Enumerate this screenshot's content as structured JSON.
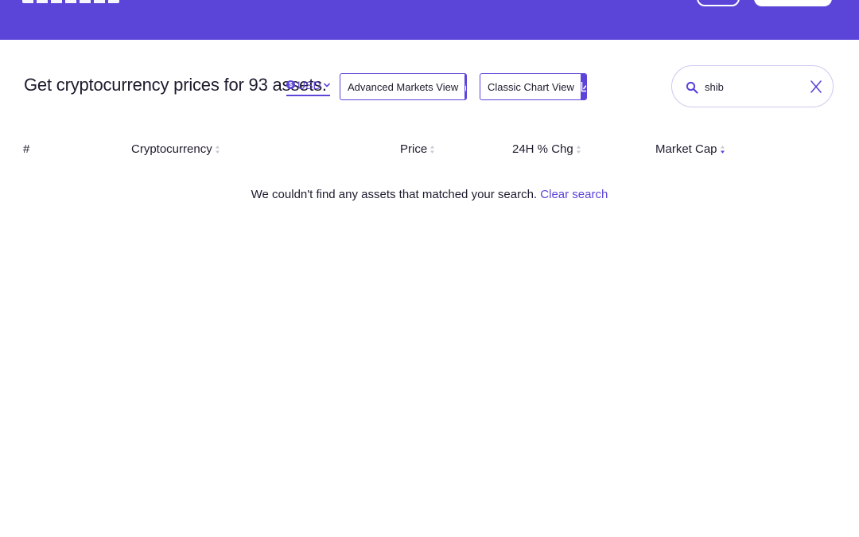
{
  "header": {
    "brand_logo_icon": "brand-wordmark",
    "background_color": "#5b45d9"
  },
  "headline": "Get cryptocurrency prices for 93 assets.",
  "currency": {
    "icon": "dollar-coin-icon",
    "label": "USD"
  },
  "views": {
    "advanced_label": "Advanced Markets View",
    "advanced_icon": "candlestick-icon",
    "classic_label": "Classic Chart View",
    "classic_icon": "line-chart-icon"
  },
  "search": {
    "value": "shib",
    "icon": "search-icon",
    "clear_icon": "close-icon"
  },
  "table": {
    "columns": [
      "#",
      "Cryptocurrency",
      "Price",
      "24H % Chg",
      "Market Cap"
    ],
    "sorted_column": "Market Cap",
    "sort_direction": "descending"
  },
  "empty_state": {
    "message": "We couldn't find any assets that matched your search.",
    "clear_link": "Clear search"
  },
  "colors": {
    "accent": "#5b45d9",
    "text": "#1f1b2e",
    "search_border": "#cfc8f0"
  }
}
